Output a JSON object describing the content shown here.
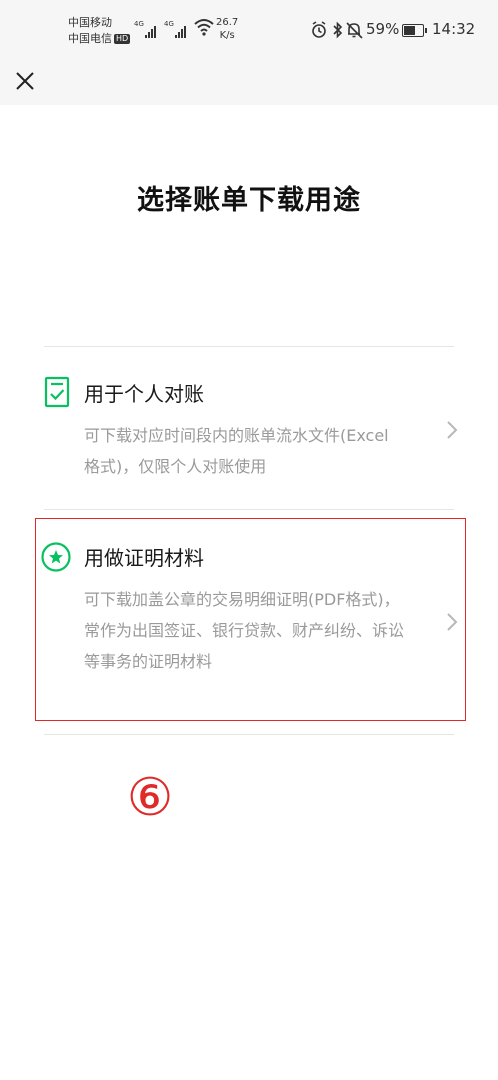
{
  "status_bar": {
    "carrier_1": "中国移动",
    "carrier_2": "中国电信",
    "hd": "HD",
    "network_1": "4G",
    "network_2": "4G",
    "speed_value": "26.7",
    "speed_unit": "K/s",
    "battery_text": "59%",
    "battery_level": 0.59,
    "time": "14:32"
  },
  "header": {
    "close_icon": "close-icon"
  },
  "page": {
    "title": "选择账单下载用途"
  },
  "options": [
    {
      "title": "用于个人对账",
      "desc": "可下载对应时间段内的账单流水文件(Excel格式)，仅限个人对账使用",
      "icon": "document-check-icon"
    },
    {
      "title": "用做证明材料",
      "desc": "可下载加盖公章的交易明细证明(PDF格式)，常作为出国签证、银行贷款、财产纠纷、诉讼等事务的证明材料",
      "icon": "star-badge-icon"
    }
  ],
  "annotation": {
    "step_marker": "⑥"
  },
  "colors": {
    "accent": "#07c160",
    "highlight": "#e02a2a"
  }
}
